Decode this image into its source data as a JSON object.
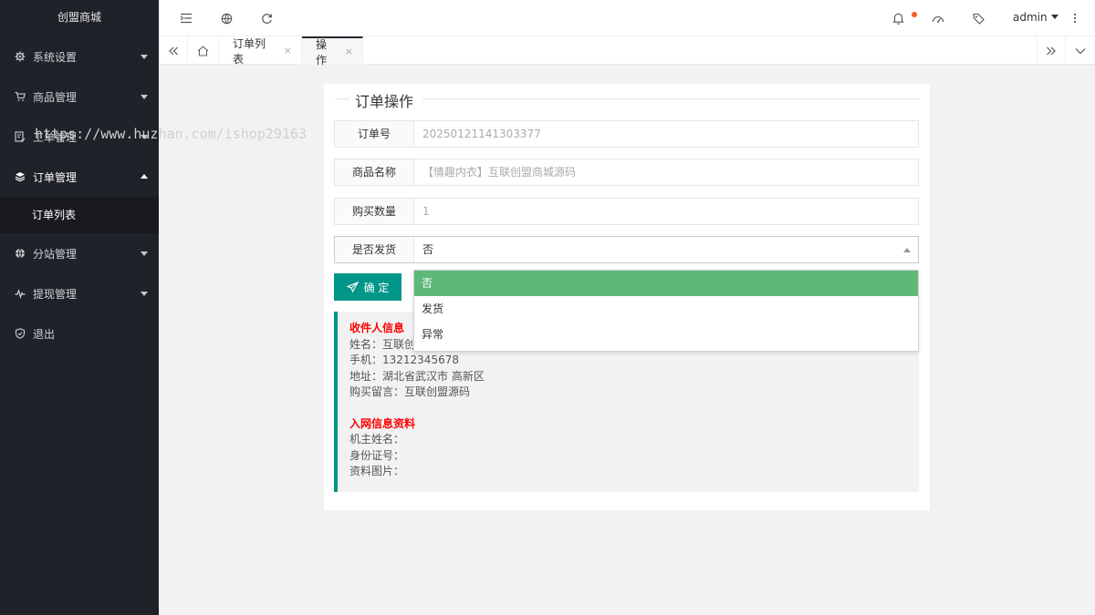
{
  "app": {
    "logo": "创盟商城"
  },
  "sidebar": {
    "items": [
      {
        "label": "系统设置",
        "icon": "gear-icon"
      },
      {
        "label": "商品管理",
        "icon": "cart-icon"
      },
      {
        "label": "工单管理",
        "icon": "ticket-icon"
      },
      {
        "label": "订单管理",
        "icon": "layers-icon",
        "expanded": true,
        "children": [
          {
            "label": "订单列表"
          }
        ]
      },
      {
        "label": "分站管理",
        "icon": "globe-icon"
      },
      {
        "label": "提现管理",
        "icon": "pulse-icon"
      },
      {
        "label": "退出",
        "icon": "shield-icon"
      }
    ]
  },
  "header": {
    "user": "admin",
    "notification_dot_color": "#ff5722"
  },
  "tabs": [
    {
      "label": "订单列表",
      "close": "×"
    },
    {
      "label": "操作",
      "close": "×",
      "active": true
    }
  ],
  "form": {
    "legend": "订单操作",
    "fields": [
      {
        "label": "订单号",
        "value": "20250121141303377"
      },
      {
        "label": "商品名称",
        "value": "【情趣内衣】互联创盟商城源码"
      },
      {
        "label": "购买数量",
        "value": "1"
      },
      {
        "label": "是否发货",
        "value": "否"
      }
    ],
    "select_options": [
      "否",
      "发货",
      "异常"
    ],
    "submit_label": "确 定"
  },
  "info": {
    "recipient_title": "收件人信息",
    "name": "姓名：互联创盟",
    "phone": "手机：13212345678",
    "address": "地址：湖北省武汉市 高新区",
    "message": "购买留言：互联创盟源码",
    "network_title": "入网信息资料",
    "owner_name": "机主姓名：",
    "id_number": "身份证号：",
    "photos": "资料图片："
  },
  "watermark": "https://www.huzhan.com/ishop29163",
  "colors": {
    "sidebar": "#20222a",
    "accent": "#009688",
    "selected_option": "#5fb878",
    "heading_red": "#ff0000"
  }
}
